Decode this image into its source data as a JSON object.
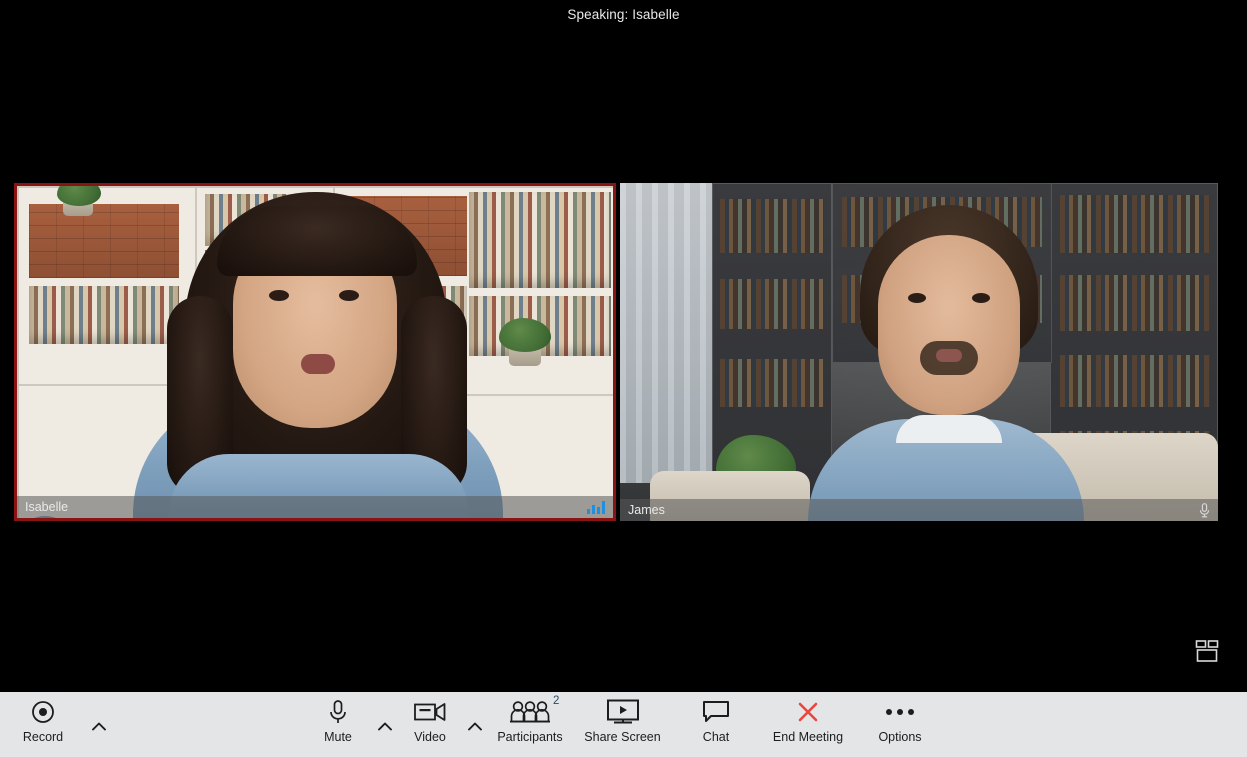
{
  "app": {
    "speaking_banner": "Speaking: Isabelle",
    "background_color": "#000000",
    "toolbar_color": "#e4e5e7",
    "active_speaker_border_color": "#8a1414",
    "accent_blue": "#1f8fe0",
    "end_meeting_color": "#e8453c"
  },
  "stage": {
    "layout_toggle_name": "gallery-view-toggle",
    "tiles": [
      {
        "name": "Isabelle",
        "active_speaker": true,
        "status_icon": "audio-level-icon",
        "audio_levels": [
          4,
          8,
          6,
          11
        ]
      },
      {
        "name": "James",
        "active_speaker": false,
        "status_icon": "microphone-icon"
      }
    ]
  },
  "toolbar": {
    "items": [
      {
        "id": "record",
        "label": "Record",
        "icon": "record-icon",
        "caret": true
      },
      {
        "id": "mute",
        "label": "Mute",
        "icon": "microphone-icon",
        "caret": true
      },
      {
        "id": "video",
        "label": "Video",
        "icon": "video-camera-icon",
        "caret": true
      },
      {
        "id": "participants",
        "label": "Participants",
        "icon": "participants-icon",
        "badge": "2",
        "caret": false
      },
      {
        "id": "share-screen",
        "label": "Share Screen",
        "icon": "share-screen-icon",
        "caret": false
      },
      {
        "id": "chat",
        "label": "Chat",
        "icon": "chat-bubble-icon",
        "caret": false
      },
      {
        "id": "end-meeting",
        "label": "End Meeting",
        "icon": "close-x-icon",
        "caret": false
      },
      {
        "id": "options",
        "label": "Options",
        "icon": "ellipsis-icon",
        "caret": false
      }
    ]
  }
}
